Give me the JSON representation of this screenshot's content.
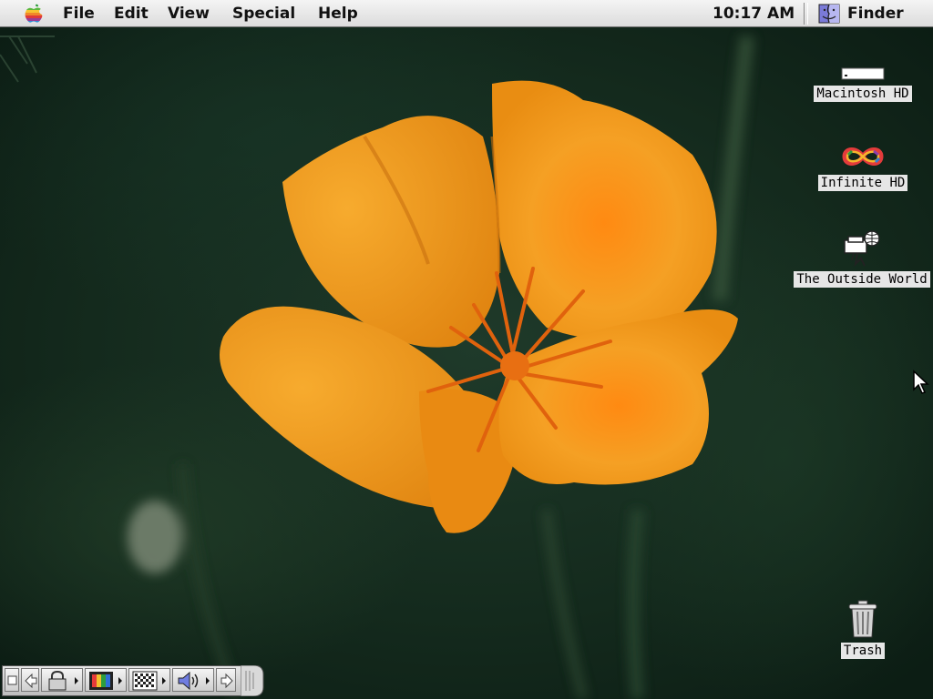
{
  "menubar": {
    "apple_icon": "apple-rainbow-icon",
    "items": [
      {
        "label": "File"
      },
      {
        "label": "Edit"
      },
      {
        "label": "View"
      },
      {
        "label": "Special"
      },
      {
        "label": "Help"
      }
    ],
    "clock": "10:17 AM",
    "app_icon": "finder-icon",
    "app_name": "Finder"
  },
  "desktop": {
    "wallpaper": "orange-california-poppy-photo",
    "icons": [
      {
        "label": "Macintosh HD",
        "icon": "hard-disk-icon"
      },
      {
        "label": "Infinite HD",
        "icon": "infinity-rainbow-icon"
      },
      {
        "label": "The Outside World",
        "icon": "network-globe-icon"
      },
      {
        "label": "Trash",
        "icon": "trash-can-icon"
      }
    ]
  },
  "control_strip": {
    "modules": [
      "collapse-tab-icon",
      "arrow-left-icon",
      "lock-icon",
      "monitor-colors-icon",
      "resolution-grid-icon",
      "speaker-volume-icon",
      "arrow-right-icon",
      "strip-end-tab-icon"
    ]
  },
  "colors": {
    "menubar": "#e6e6e6",
    "petal_orange": "#f39a1c",
    "wallpaper_green": "#1b3526"
  }
}
